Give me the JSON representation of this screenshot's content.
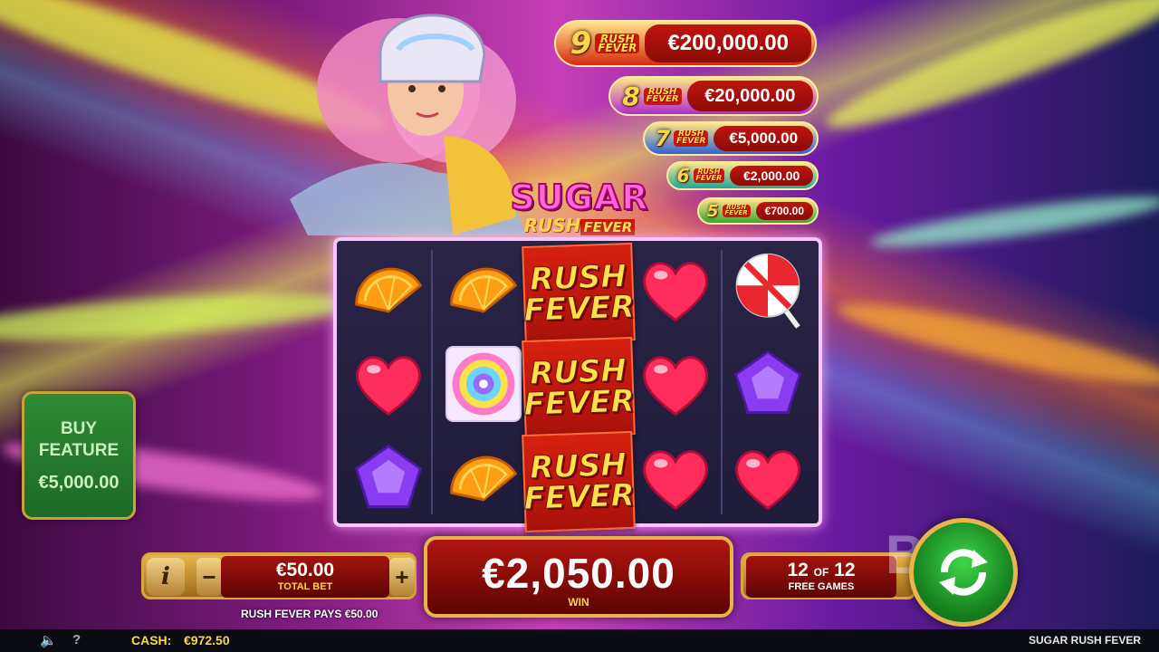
{
  "game_title": "SUGAR RUSH FEVER",
  "logo": {
    "line1": "SUGAR",
    "line2": "RUSH",
    "line2_tag": "FEVER"
  },
  "ladder": [
    {
      "count": "9",
      "tag_line1": "RUSH",
      "tag_line2": "FEVER",
      "prize": "€200,000.00",
      "color": "#d62a10"
    },
    {
      "count": "8",
      "tag_line1": "RUSH",
      "tag_line2": "FEVER",
      "prize": "€20,000.00",
      "color": "#b22bd0"
    },
    {
      "count": "7",
      "tag_line1": "RUSH",
      "tag_line2": "FEVER",
      "prize": "€5,000.00",
      "color": "#2f62d8"
    },
    {
      "count": "6",
      "tag_line1": "RUSH",
      "tag_line2": "FEVER",
      "prize": "€2,000.00",
      "color": "#1da99a"
    },
    {
      "count": "5",
      "tag_line1": "RUSH",
      "tag_line2": "FEVER",
      "prize": "€700.00",
      "color": "#3aa830"
    }
  ],
  "reels": [
    [
      "orange-slice",
      "red-heart",
      "purple-gem"
    ],
    [
      "orange-slice",
      "swirl-candy",
      "orange-slice"
    ],
    [
      "rush-fever",
      "rush-fever",
      "rush-fever"
    ],
    [
      "red-heart",
      "red-heart",
      "red-heart"
    ],
    [
      "lollipop",
      "purple-gem",
      "red-heart"
    ]
  ],
  "rush_tile": {
    "line1": "RUSH",
    "line2": "FEVER"
  },
  "buy_feature": {
    "line1": "BUY",
    "line2": "FEATURE",
    "price": "€5,000.00"
  },
  "bet": {
    "info": "i",
    "minus": "−",
    "plus": "+",
    "value": "€50.00",
    "caption": "TOTAL BET"
  },
  "win": {
    "value": "€2,050.00",
    "caption": "WIN"
  },
  "free_games": {
    "current": "12",
    "of": "OF",
    "total": "12",
    "caption": "FREE GAMES"
  },
  "rush_pays_text": "RUSH FEVER PAYS €50.00",
  "status": {
    "cash_label": "CASH:",
    "cash_value": "€972.50"
  },
  "watermark": "BET",
  "colors": {
    "accent_gold": "#e7b44a",
    "win_red": "#b3150f",
    "spin_green": "#3fd649"
  }
}
